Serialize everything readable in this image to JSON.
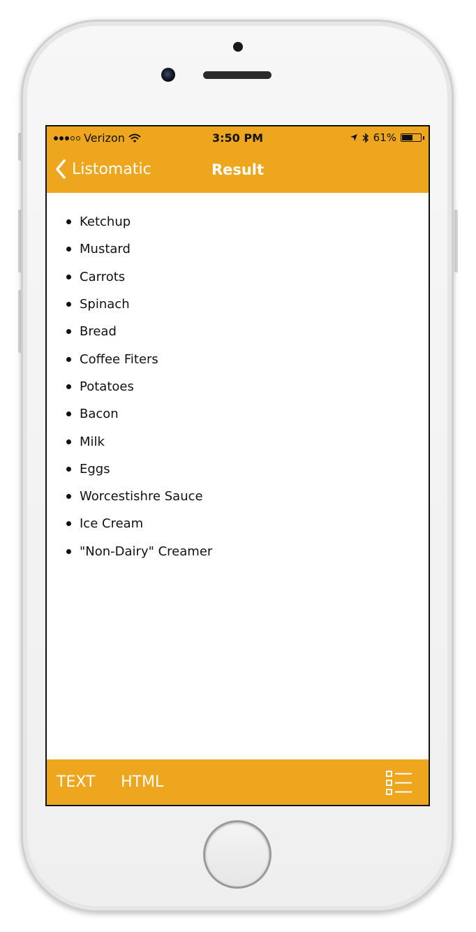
{
  "status_bar": {
    "carrier": "Verizon",
    "time": "3:50 PM",
    "battery": "61%",
    "battery_level": 0.61
  },
  "nav": {
    "back_label": "Listomatic",
    "title": "Result"
  },
  "list": {
    "items": [
      "Ketchup",
      "Mustard",
      "Carrots",
      "Spinach",
      "Bread",
      "Coffee Fiters",
      "Potatoes",
      "Bacon",
      "Milk",
      "Eggs",
      "Worcestishre Sauce",
      "Ice Cream",
      "\"Non-Dairy\" Creamer"
    ]
  },
  "toolbar": {
    "text_label": "TEXT",
    "html_label": "HTML",
    "list_icon": "checklist-icon"
  },
  "colors": {
    "accent": "#eea61e"
  }
}
